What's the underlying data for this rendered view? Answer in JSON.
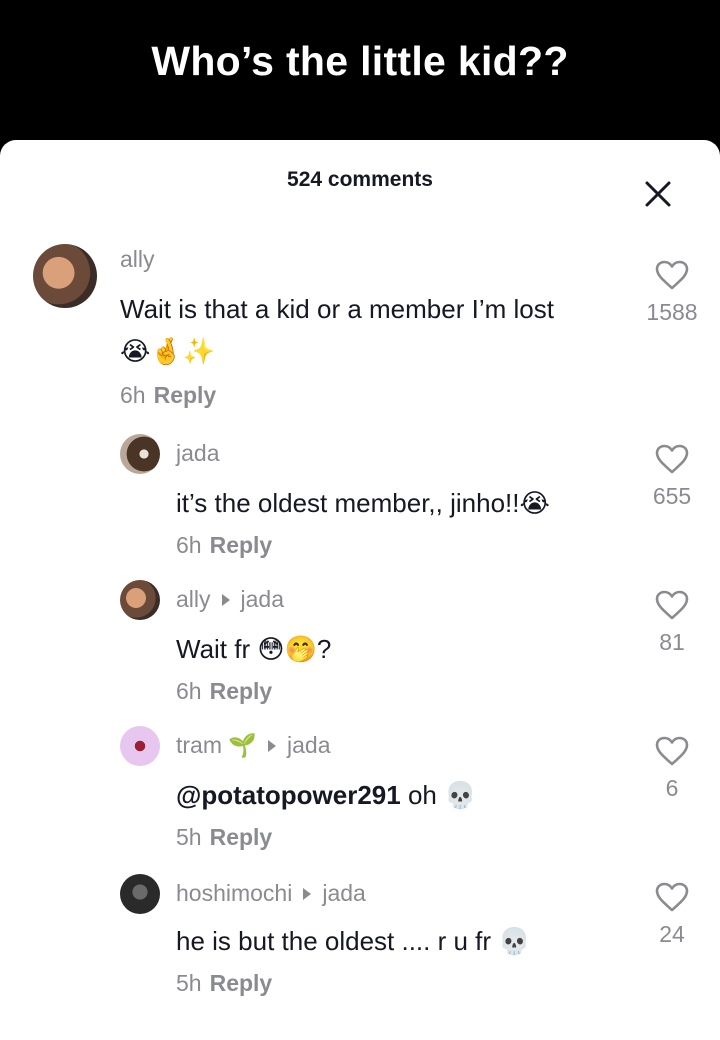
{
  "video": {
    "caption": "Who’s the little kid??"
  },
  "comments_panel": {
    "count_label": "524 comments",
    "close_icon": "close-icon"
  },
  "comments": [
    {
      "user": "ally",
      "reply_to": "",
      "text": "Wait is that a kid or a member I’m lost",
      "text_line2": "😭🤞✨",
      "time": "6h",
      "reply_label": "Reply",
      "likes": "1588"
    },
    {
      "user": "jada",
      "reply_to": "",
      "text": "it’s the oldest member,, jinho!!😭",
      "time": "6h",
      "reply_label": "Reply",
      "likes": "655"
    },
    {
      "user": "ally",
      "reply_to": "jada",
      "text": "Wait fr 😳🤭?",
      "time": "6h",
      "reply_label": "Reply",
      "likes": "81"
    },
    {
      "user": "tram 🌱",
      "reply_to": "jada",
      "mention": "@potatopower291",
      "text": " oh 💀",
      "time": "5h",
      "reply_label": "Reply",
      "likes": "6"
    },
    {
      "user": "hoshimochi",
      "reply_to": "jada",
      "text": "he is but the oldest .... r u fr 💀",
      "time": "5h",
      "reply_label": "Reply",
      "likes": "24"
    }
  ],
  "colors": {
    "text_primary": "#161823",
    "text_secondary": "#8a8b91",
    "sheet_bg": "#ffffff"
  }
}
